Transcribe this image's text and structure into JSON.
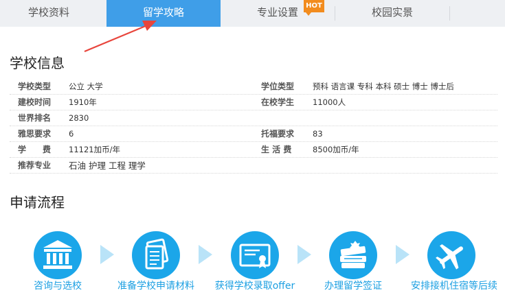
{
  "tabs": [
    {
      "label": "学校资料",
      "active": false
    },
    {
      "label": "留学攻略",
      "active": true
    },
    {
      "label": "专业设置",
      "active": false,
      "badge": "HOT"
    },
    {
      "label": "校园实景",
      "active": false
    }
  ],
  "colors": {
    "accent": "#3f9ee8",
    "process": "#1ba6e9",
    "badge": "#f28c1e",
    "annotation": "#e8453c"
  },
  "school_info": {
    "title": "学校信息",
    "rows": [
      {
        "left_label": "学校类型",
        "left_value": "公立 大学",
        "right_label": "学位类型",
        "right_value": "预科 语言课 专科 本科 硕士 博士 博士后"
      },
      {
        "left_label": "建校时间",
        "left_value": "1910年",
        "right_label": "在校学生",
        "right_value": "11000人"
      },
      {
        "left_label": "世界排名",
        "left_value": "2830",
        "right_label": "",
        "right_value": ""
      },
      {
        "left_label": "雅思要求",
        "left_value": "6",
        "right_label": "托福要求",
        "right_value": "83"
      },
      {
        "left_label": "学　　费",
        "left_value": "11121加币/年",
        "right_label": "生 活 费",
        "right_value": "8500加币/年"
      },
      {
        "left_label": "推荐专业",
        "left_value": "石油 护理 工程 理学",
        "right_label": "",
        "right_value": ""
      }
    ]
  },
  "process": {
    "title": "申请流程",
    "steps": [
      {
        "label": "咨询与选校",
        "icon": "bank-building-icon"
      },
      {
        "label": "准备学校申请材料",
        "icon": "documents-icon"
      },
      {
        "label": "获得学校录取offer",
        "icon": "certificate-icon"
      },
      {
        "label": "办理留学签证",
        "icon": "passport-books-icon"
      },
      {
        "label": "安排接机住宿等后续",
        "icon": "airplane-icon"
      }
    ]
  }
}
